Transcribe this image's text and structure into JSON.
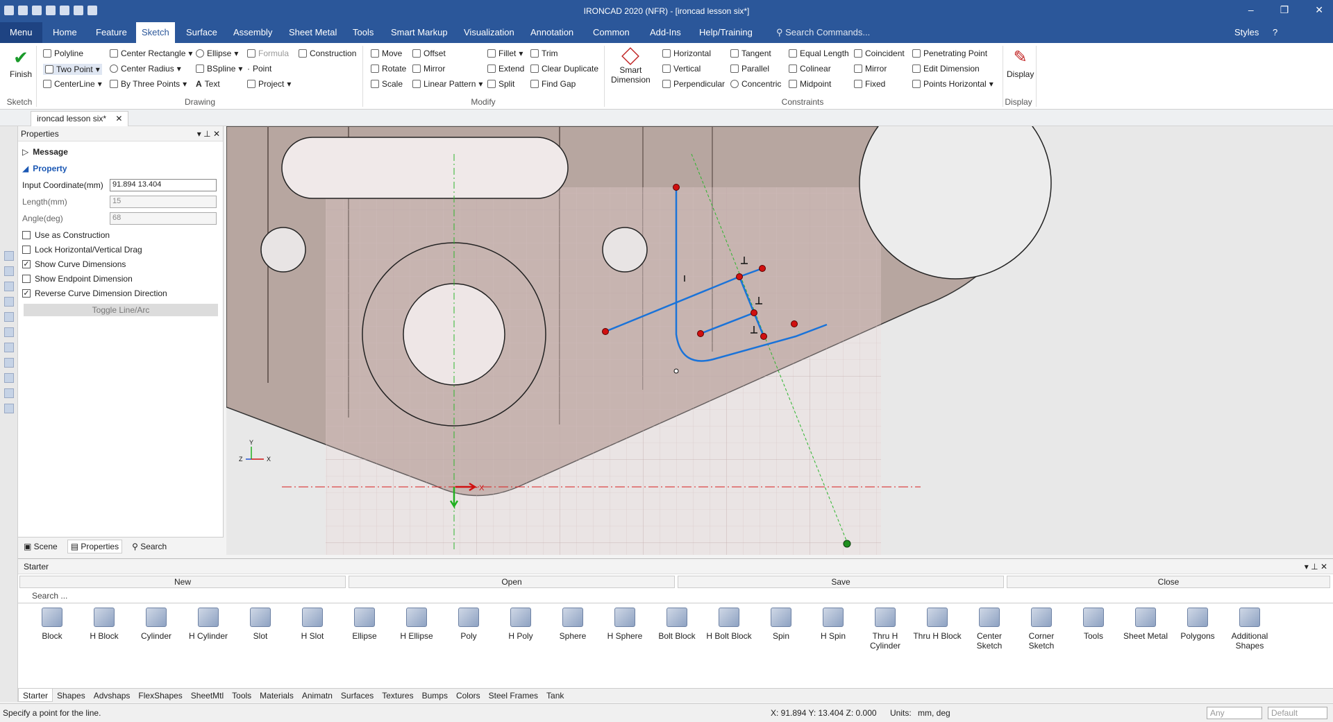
{
  "title": "IRONCAD 2020 (NFR) - [ironcad lesson six*]",
  "window_controls": [
    "–",
    "❐",
    "✕"
  ],
  "menu_tabs": [
    "Menu",
    "Home",
    "Feature",
    "Sketch",
    "Surface",
    "Assembly",
    "Sheet Metal",
    "Tools",
    "Smart Markup",
    "Visualization",
    "Annotation",
    "Common",
    "Add-Ins",
    "Help/Training"
  ],
  "active_tab": "Sketch",
  "search_commands_placeholder": "Search Commands...",
  "styles_label": "Styles",
  "ribbon": {
    "finish": "Finish",
    "drawing": [
      "Polyline",
      "Center Rectangle",
      "Formula",
      "Construction",
      "Two Point",
      "Center Radius",
      "BSpline",
      "Point",
      "CenterLine",
      "By Three Points",
      "Text",
      "Project",
      "Ellipse"
    ],
    "modify": [
      "Move",
      "Offset",
      "Fillet",
      "Trim",
      "Rotate",
      "Mirror",
      "Extend",
      "Clear Duplicate",
      "Scale",
      "Linear Pattern",
      "Split",
      "Find Gap"
    ],
    "smart_dimension": [
      "Smart",
      "Dimension"
    ],
    "constraints": [
      "Horizontal",
      "Tangent",
      "Equal Length",
      "Coincident",
      "Penetrating Point",
      "Vertical",
      "Parallel",
      "Colinear",
      "Mirror",
      "Edit Dimension",
      "Perpendicular",
      "Concentric",
      "Midpoint",
      "Fixed",
      "Points Horizontal"
    ],
    "display": "Display",
    "groups": [
      "Sketch",
      "Drawing",
      "Modify",
      "Constraints",
      "Display"
    ]
  },
  "doc_tab": "ironcad lesson six*",
  "properties": {
    "title": "Properties",
    "message": "Message",
    "property": "Property",
    "input_coord_label": "Input Coordinate(mm)",
    "input_coord_value": "91.894 13.404",
    "length_label": "Length(mm)",
    "length_value": "15",
    "angle_label": "Angle(deg)",
    "angle_value": "68",
    "checks": [
      {
        "label": "Use as Construction",
        "checked": false
      },
      {
        "label": "Lock Horizontal/Vertical Drag",
        "checked": false
      },
      {
        "label": "Show Curve Dimensions",
        "checked": true
      },
      {
        "label": "Show Endpoint Dimension",
        "checked": false
      },
      {
        "label": "Reverse Curve Dimension Direction",
        "checked": true
      }
    ],
    "toggle_button": "Toggle Line/Arc",
    "footer_tabs": [
      "Scene",
      "Properties",
      "Search"
    ]
  },
  "starter": {
    "title": "Starter",
    "buttons": [
      "New",
      "Open",
      "Save",
      "Close"
    ],
    "search_placeholder": "Search ...",
    "items": [
      "Block",
      "H Block",
      "Cylinder",
      "H Cylinder",
      "Slot",
      "H Slot",
      "Ellipse",
      "H Ellipse",
      "Poly",
      "H Poly",
      "Sphere",
      "H Sphere",
      "Bolt Block",
      "H Bolt Block",
      "Spin",
      "H Spin",
      "Thru H Cylinder",
      "Thru H Block",
      "Center Sketch",
      "Corner Sketch",
      "Tools",
      "Sheet Metal",
      "Polygons",
      "Additional Shapes"
    ],
    "library_tabs": [
      "Starter",
      "Shapes",
      "Advshaps",
      "FlexShapes",
      "SheetMtl",
      "Tools",
      "Materials",
      "Animatn",
      "Surfaces",
      "Textures",
      "Bumps",
      "Colors",
      "Steel Frames",
      "Tank"
    ]
  },
  "status": {
    "message": "Specify a point for the line.",
    "coords": "X: 91.894 Y: 13.404 Z: 0.000",
    "units_label": "Units:",
    "units_value": "mm, deg",
    "any": "Any",
    "default": "Default"
  },
  "axis_labels": {
    "x": "X",
    "y": "Y",
    "z": "Z"
  },
  "colors": {
    "brand": "#2b579a",
    "sketch": "#1a73d9",
    "point": "#d01010"
  }
}
